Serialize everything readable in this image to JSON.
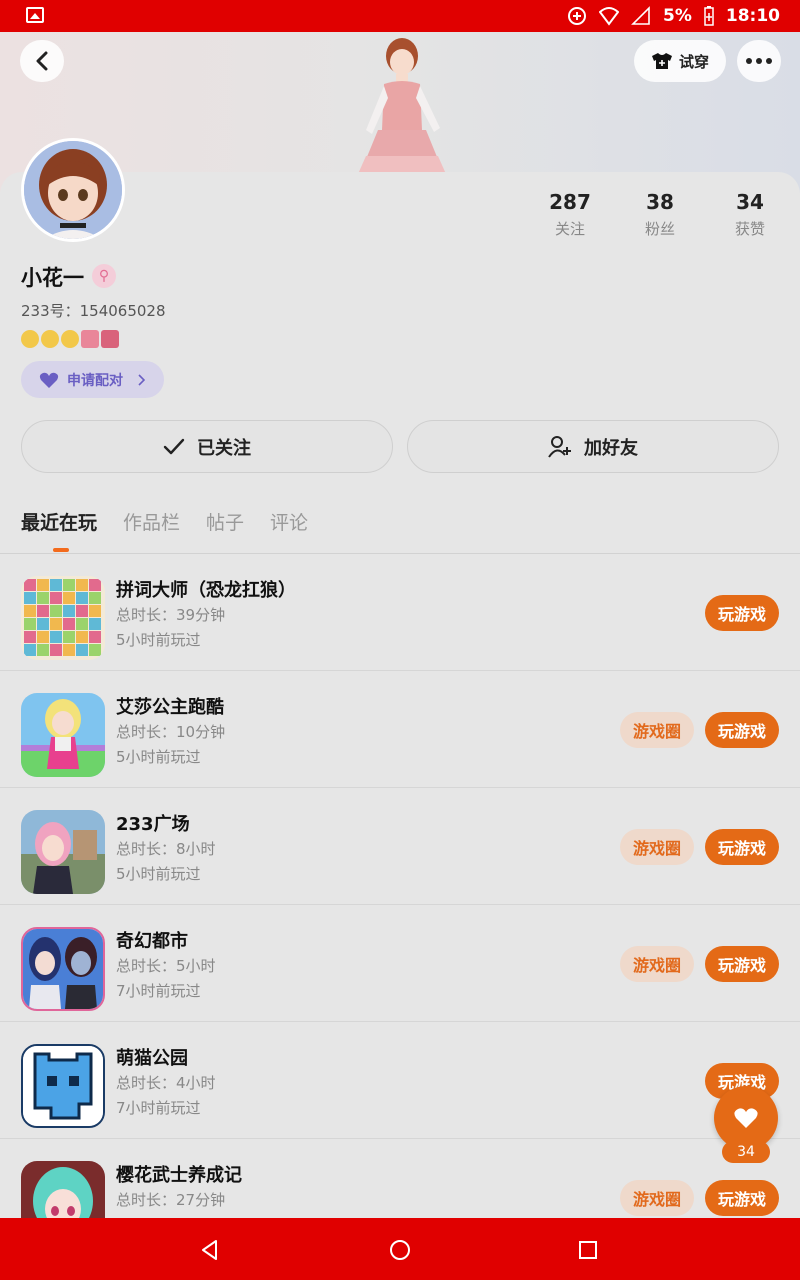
{
  "status_bar": {
    "battery": "5%",
    "time": "18:10"
  },
  "header": {
    "try_on_label": "试穿"
  },
  "profile": {
    "username": "小花一",
    "gender_symbol": "⚲",
    "uid": "233号：154065028",
    "pair_label": "申请配对",
    "stats": [
      {
        "value": "287",
        "label": "关注"
      },
      {
        "value": "38",
        "label": "粉丝"
      },
      {
        "value": "34",
        "label": "获赞"
      }
    ]
  },
  "actions": {
    "followed_label": "已关注",
    "add_friend_label": "加好友"
  },
  "tabs": [
    {
      "label": "最近在玩"
    },
    {
      "label": "作品栏"
    },
    {
      "label": "帖子"
    },
    {
      "label": "评论"
    }
  ],
  "games": [
    {
      "name": "拼词大师（恐龙扛狼）",
      "duration": "总时长：39分钟",
      "last_played": "5小时前玩过",
      "play_label": "玩游戏",
      "circle_label": ""
    },
    {
      "name": "艾莎公主跑酷",
      "duration": "总时长：10分钟",
      "last_played": "5小时前玩过",
      "play_label": "玩游戏",
      "circle_label": "游戏圈"
    },
    {
      "name": "233广场",
      "duration": "总时长：8小时",
      "last_played": "5小时前玩过",
      "play_label": "玩游戏",
      "circle_label": "游戏圈"
    },
    {
      "name": "奇幻都市",
      "duration": "总时长：5小时",
      "last_played": "7小时前玩过",
      "play_label": "玩游戏",
      "circle_label": "游戏圈"
    },
    {
      "name": "萌猫公园",
      "duration": "总时长：4小时",
      "last_played": "7小时前玩过",
      "play_label": "玩游戏",
      "circle_label": ""
    },
    {
      "name": "樱花武士养成记",
      "duration": "总时长：27分钟",
      "last_played": "",
      "play_label": "玩游戏",
      "circle_label": "游戏圈"
    }
  ],
  "like_fab": {
    "count": "34"
  },
  "colors": {
    "accent": "#e46a16",
    "status_bar": "#e00000",
    "pair_text": "#6a5fc3"
  }
}
